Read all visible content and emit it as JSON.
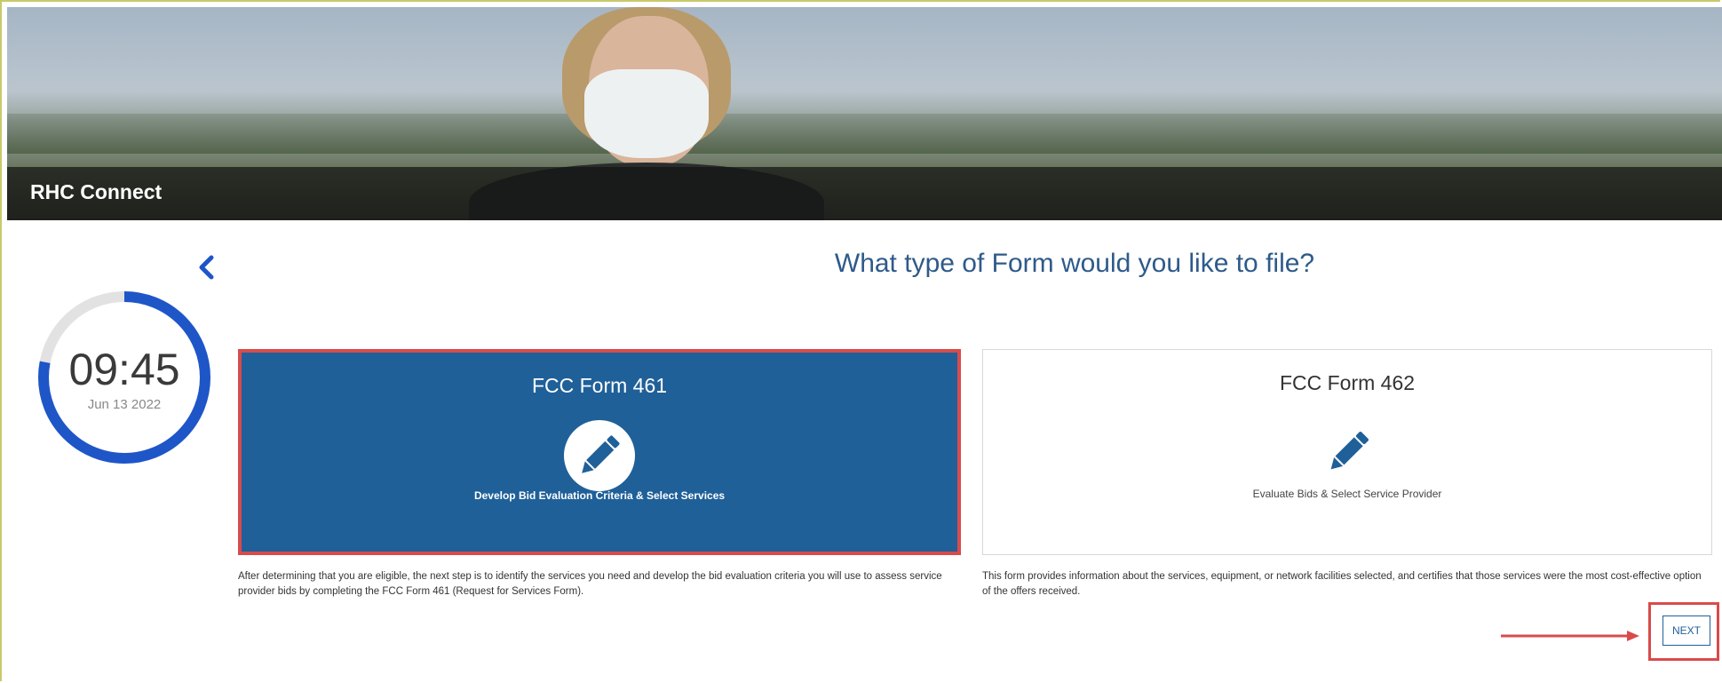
{
  "header": {
    "title": "RHC Connect"
  },
  "timer": {
    "time": "09:45",
    "date": "Jun 13 2022",
    "progress": 0.78,
    "track_color": "#e2e2e2",
    "fill_color": "#1e56c8"
  },
  "main": {
    "question": "What type of Form would you like to file?",
    "cards": [
      {
        "title": "FCC Form 461",
        "subtitle": "Develop Bid Evaluation Criteria & Select Services",
        "selected": true,
        "icon": "pencil-icon",
        "description": "After determining that you are eligible, the next step is to identify the services you need and develop the bid evaluation criteria you will use to assess service provider bids by completing the FCC Form 461 (Request for Services Form)."
      },
      {
        "title": "FCC Form 462",
        "subtitle": "Evaluate Bids & Select Service Provider",
        "selected": false,
        "icon": "pencil-icon",
        "description": "This form provides information about the services, equipment, or network facilities selected, and certifies that those services were the most cost-effective option of the offers received."
      }
    ],
    "next_label": "NEXT"
  },
  "colors": {
    "primary": "#1f6099",
    "heading": "#2e5a8a",
    "highlight": "#d94b4b"
  }
}
